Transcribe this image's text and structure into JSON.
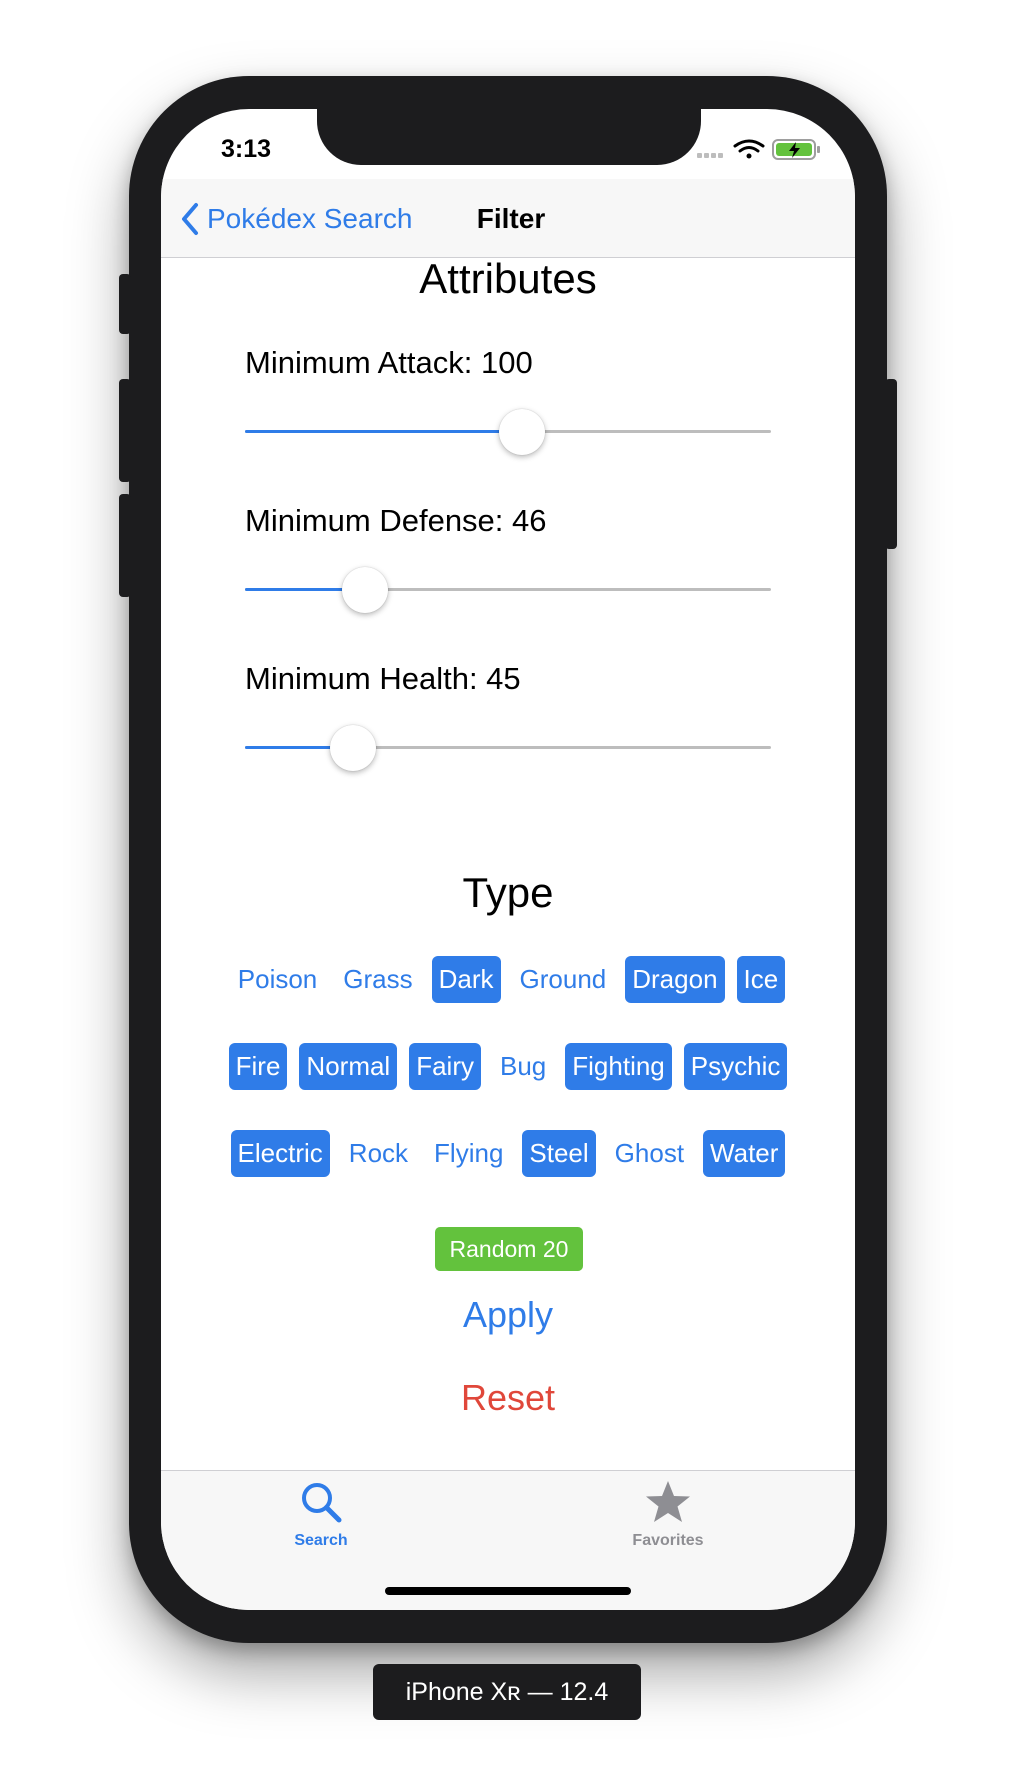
{
  "status": {
    "time": "3:13"
  },
  "nav": {
    "back_label": "Pokédex Search",
    "title": "Filter"
  },
  "attributes": {
    "title": "Attributes",
    "sliders": [
      {
        "label": "Minimum Attack: 100",
        "value": 0.527
      },
      {
        "label": "Minimum Defense: 46",
        "value": 0.228
      },
      {
        "label": "Minimum Health: 45",
        "value": 0.205
      }
    ]
  },
  "type_section": {
    "title": "Type",
    "rows": [
      [
        {
          "label": "Poison",
          "selected": false
        },
        {
          "label": "Grass",
          "selected": false
        },
        {
          "label": "Dark",
          "selected": true
        },
        {
          "label": "Ground",
          "selected": false
        },
        {
          "label": "Dragon",
          "selected": true
        },
        {
          "label": "Ice",
          "selected": true
        }
      ],
      [
        {
          "label": "Fire",
          "selected": true
        },
        {
          "label": "Normal",
          "selected": true
        },
        {
          "label": "Fairy",
          "selected": true
        },
        {
          "label": "Bug",
          "selected": false
        },
        {
          "label": "Fighting",
          "selected": true
        },
        {
          "label": "Psychic",
          "selected": true
        }
      ],
      [
        {
          "label": "Electric",
          "selected": true
        },
        {
          "label": "Rock",
          "selected": false
        },
        {
          "label": "Flying",
          "selected": false
        },
        {
          "label": "Steel",
          "selected": true
        },
        {
          "label": "Ghost",
          "selected": false
        },
        {
          "label": "Water",
          "selected": true
        }
      ]
    ]
  },
  "actions": {
    "random": "Random 20",
    "apply": "Apply",
    "reset": "Reset"
  },
  "tabbar": {
    "search": "Search",
    "favorites": "Favorites"
  },
  "device_label": "iPhone Xʀ — 12.4",
  "colors": {
    "accent": "#2f7ce8",
    "random": "#63c23d",
    "reset": "#e0473a",
    "inactive_tab": "#8e8e93"
  }
}
